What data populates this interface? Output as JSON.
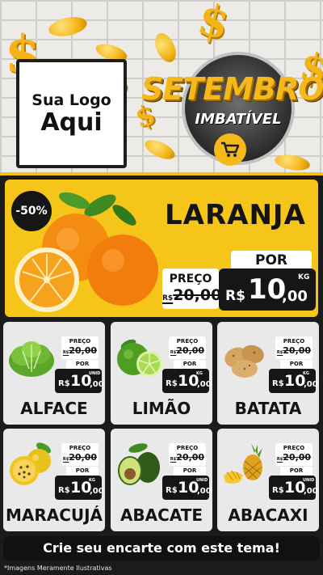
{
  "header": {
    "logo_line1": "Sua Logo",
    "logo_line2": "Aqui",
    "badge_title": "SETEMBRO",
    "badge_subtitle": "IMBATÍVEL",
    "cart_icon": "shopping-cart-icon"
  },
  "featured": {
    "discount": "-50%",
    "name": "LARANJA",
    "old_label": "PREÇO",
    "old_currency": "R$",
    "old_price": "20,00",
    "por_label": "POR",
    "currency": "R$",
    "price_int": "10",
    "price_dec": ",00",
    "unit": "KG",
    "icon": "orange-icon"
  },
  "products": [
    {
      "name": "ALFACE",
      "old_label": "PREÇO",
      "old_currency": "R$",
      "old_price": "20,00",
      "por_label": "POR",
      "currency": "R$",
      "price_int": "10",
      "price_dec": ",00",
      "unit": "UNID",
      "icon": "lettuce-icon"
    },
    {
      "name": "LIMÃO",
      "old_label": "PREÇO",
      "old_currency": "R$",
      "old_price": "20,00",
      "por_label": "POR",
      "currency": "R$",
      "price_int": "10",
      "price_dec": ",00",
      "unit": "KG",
      "icon": "lime-icon"
    },
    {
      "name": "BATATA",
      "old_label": "PREÇO",
      "old_currency": "R$",
      "old_price": "20,00",
      "por_label": "POR",
      "currency": "R$",
      "price_int": "10",
      "price_dec": ",00",
      "unit": "KG",
      "icon": "potato-icon"
    },
    {
      "name": "MARACUJÁ",
      "old_label": "PREÇO",
      "old_currency": "R$",
      "old_price": "20,00",
      "por_label": "POR",
      "currency": "R$",
      "price_int": "10",
      "price_dec": ",00",
      "unit": "KG",
      "icon": "passion-fruit-icon"
    },
    {
      "name": "ABACATE",
      "old_label": "PREÇO",
      "old_currency": "R$",
      "old_price": "20,00",
      "por_label": "POR",
      "currency": "R$",
      "price_int": "10",
      "price_dec": ",00",
      "unit": "UNID",
      "icon": "avocado-icon"
    },
    {
      "name": "ABACAXI",
      "old_label": "PREÇO",
      "old_currency": "R$",
      "old_price": "20,00",
      "por_label": "POR",
      "currency": "R$",
      "price_int": "10",
      "price_dec": ",00",
      "unit": "UNID",
      "icon": "pineapple-icon"
    }
  ],
  "cta": "Crie seu encarte com este tema!",
  "footnote": "*Imagens Meramente Ilustrativas",
  "colors": {
    "brand_yellow": "#f6c51a",
    "dark": "#161616",
    "card_bg": "#e9e9e9"
  }
}
